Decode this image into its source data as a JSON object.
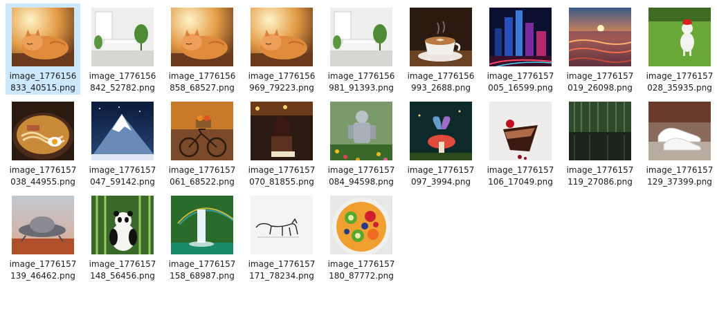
{
  "files": [
    {
      "line1": "image_1776156",
      "line2": "833_40515.png",
      "icon": "sleeping-cat-thumbnail",
      "selected": true
    },
    {
      "line1": "image_1776156",
      "line2": "842_52782.png",
      "icon": "white-living-room-thumbnail"
    },
    {
      "line1": "image_1776156",
      "line2": "858_68527.png",
      "icon": "sleeping-cat-thumbnail"
    },
    {
      "line1": "image_1776156",
      "line2": "969_79223.png",
      "icon": "sleeping-cat-thumbnail"
    },
    {
      "line1": "image_1776156",
      "line2": "981_91393.png",
      "icon": "white-living-room-thumbnail"
    },
    {
      "line1": "image_1776156",
      "line2": "993_2688.png",
      "icon": "coffee-cup-thumbnail"
    },
    {
      "line1": "image_1776157",
      "line2": "005_16599.png",
      "icon": "neon-city-thumbnail"
    },
    {
      "line1": "image_1776157",
      "line2": "019_26098.png",
      "icon": "ocean-sunset-thumbnail"
    },
    {
      "line1": "image_1776157",
      "line2": "028_35935.png",
      "icon": "dog-with-hat-thumbnail"
    },
    {
      "line1": "image_1776157",
      "line2": "038_44955.png",
      "icon": "ramen-bowl-thumbnail"
    },
    {
      "line1": "image_1776157",
      "line2": "047_59142.png",
      "icon": "snowy-mountain-thumbnail"
    },
    {
      "line1": "image_1776157",
      "line2": "061_68522.png",
      "icon": "autumn-bicycle-thumbnail"
    },
    {
      "line1": "image_1776157",
      "line2": "070_81855.png",
      "icon": "woman-reading-thumbnail"
    },
    {
      "line1": "image_1776157",
      "line2": "084_94598.png",
      "icon": "robot-in-flowers-thumbnail"
    },
    {
      "line1": "image_1776157",
      "line2": "097_3994.png",
      "icon": "fairy-mushroom-thumbnail"
    },
    {
      "line1": "image_1776157",
      "line2": "106_17049.png",
      "icon": "chocolate-cake-thumbnail"
    },
    {
      "line1": "image_1776157",
      "line2": "119_27086.png",
      "icon": "forest-lake-thumbnail"
    },
    {
      "line1": "image_1776157",
      "line2": "129_37399.png",
      "icon": "white-sneakers-thumbnail"
    },
    {
      "line1": "image_1776157",
      "line2": "139_46462.png",
      "icon": "ufo-desert-thumbnail"
    },
    {
      "line1": "image_1776157",
      "line2": "148_56456.png",
      "icon": "panda-bamboo-thumbnail"
    },
    {
      "line1": "image_1776157",
      "line2": "158_68987.png",
      "icon": "waterfall-rainbow-thumbnail"
    },
    {
      "line1": "image_1776157",
      "line2": "171_78234.png",
      "icon": "cat-line-drawing-thumbnail"
    },
    {
      "line1": "image_1776157",
      "line2": "180_87772.png",
      "icon": "fruit-salad-thumbnail"
    }
  ],
  "colors": {
    "selection": "#cce8ff",
    "background": "#ffffff"
  }
}
